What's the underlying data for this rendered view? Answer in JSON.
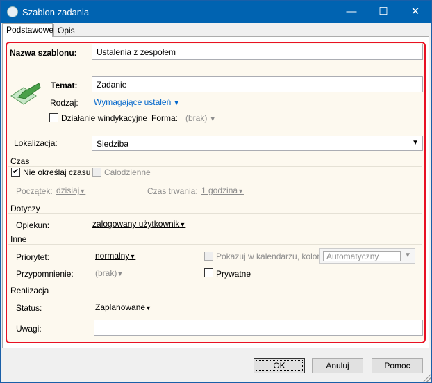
{
  "window": {
    "title": "Szablon zadania",
    "minimize": "—",
    "maximize": "☐",
    "close": "✕"
  },
  "tabs": [
    {
      "label": "Podstawowe",
      "active": true
    },
    {
      "label": "Opis",
      "active": false
    }
  ],
  "form": {
    "template_name_label": "Nazwa szablonu:",
    "template_name_value": "Ustalenia z zespołem",
    "subject_label": "Temat:",
    "subject_value": "Zadanie",
    "type_label": "Rodzaj:",
    "type_value": "Wymagające ustaleń",
    "debt_collection_label": "Działanie windykacyjne",
    "form_label": "Forma:",
    "form_value": "(brak)",
    "location_label": "Lokalizacja:",
    "location_value": "Siedziba",
    "time_section": "Czas",
    "no_time_label": "Nie określaj czasu",
    "all_day_label": "Całodzienne",
    "start_label": "Początek:",
    "start_value": "dzisiaj",
    "duration_label": "Czas trwania:",
    "duration_value": "1 godzina",
    "concerns_section": "Dotyczy",
    "guardian_label": "Opiekun:",
    "guardian_value": "zalogowany użytkownik",
    "other_section": "Inne",
    "priority_label": "Priorytet:",
    "priority_value": "normalny",
    "show_calendar_label": "Pokazuj w kalendarzu, kolor:",
    "color_value": "Automatyczny",
    "reminder_label": "Przypomnienie:",
    "reminder_value": "(brak)",
    "private_label": "Prywatne",
    "realization_section": "Realizacja",
    "status_label": "Status:",
    "status_value": "Zaplanowane",
    "notes_label": "Uwagi:",
    "notes_value": ""
  },
  "buttons": {
    "ok": "OK",
    "cancel": "Anuluj",
    "help": "Pomoc"
  },
  "colors": {
    "titlebar": "#0063b1",
    "highlight_border": "#e81123",
    "form_bg": "#fdf9ef",
    "link": "#0066cc"
  }
}
